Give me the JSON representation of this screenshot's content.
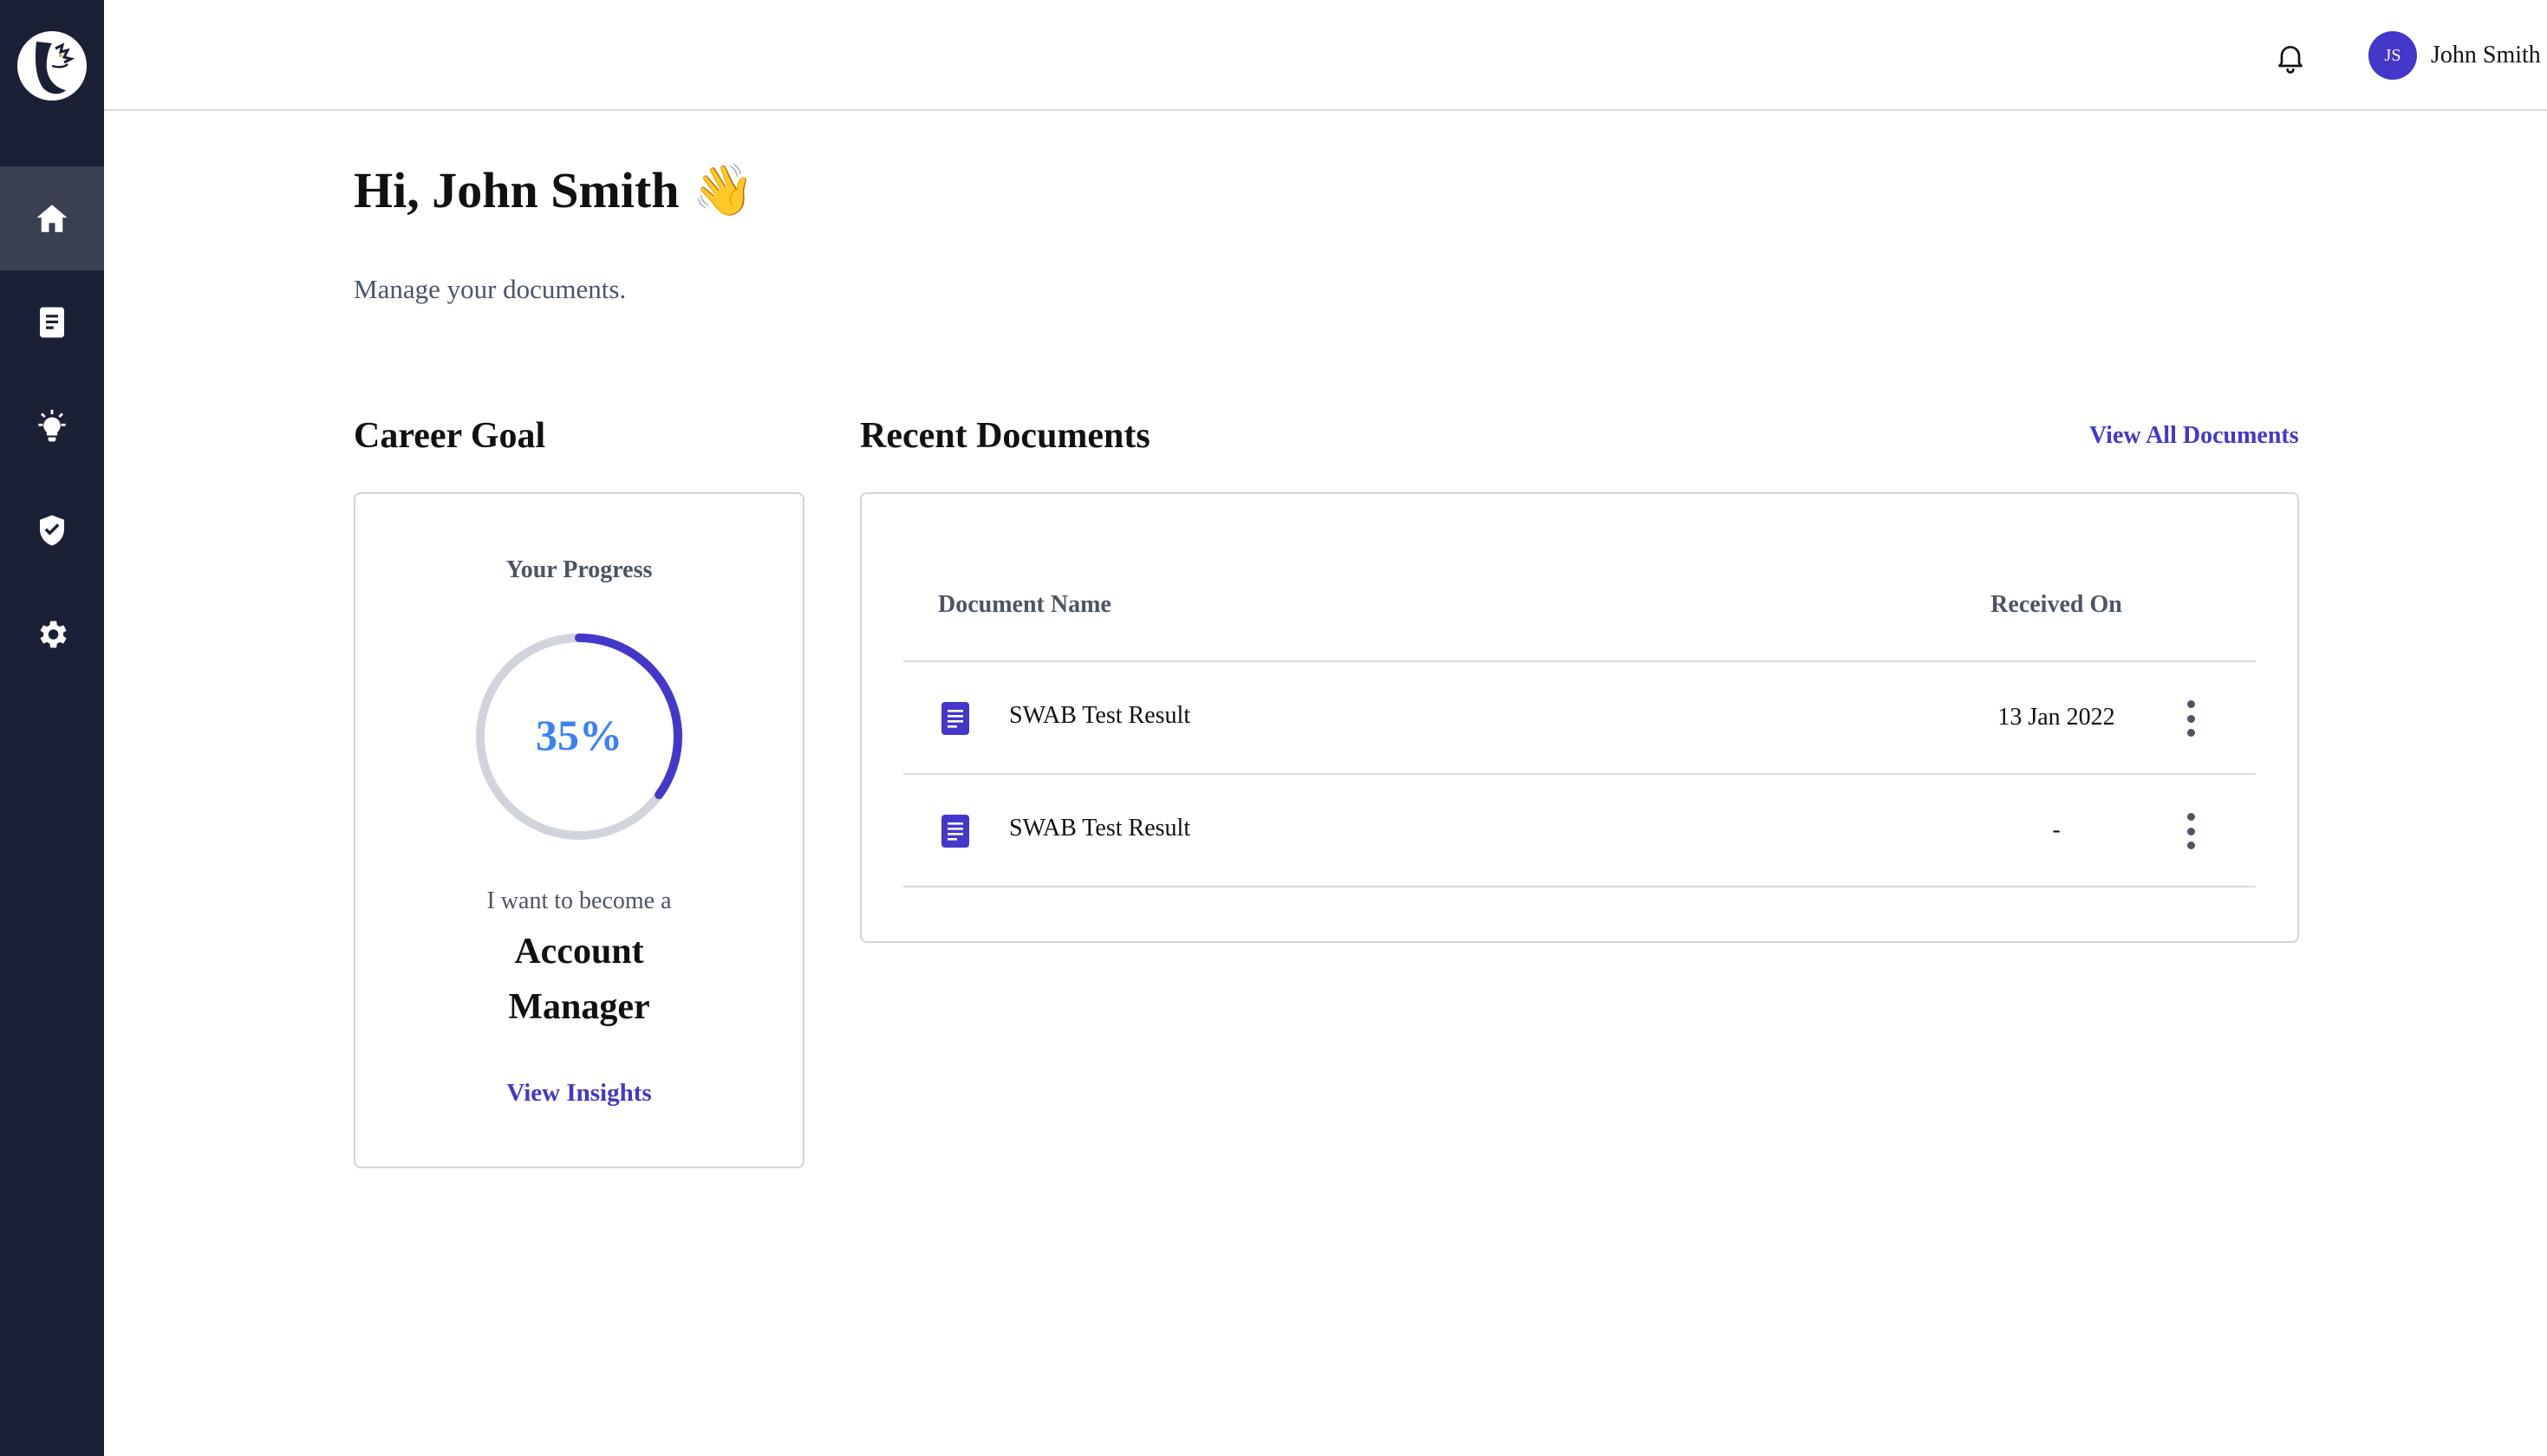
{
  "sidebar": {
    "items": [
      {
        "icon": "home-icon",
        "active": true
      },
      {
        "icon": "document-icon",
        "active": false
      },
      {
        "icon": "lightbulb-icon",
        "active": false
      },
      {
        "icon": "shield-check-icon",
        "active": false
      },
      {
        "icon": "gear-icon",
        "active": false
      }
    ]
  },
  "header": {
    "user": {
      "initials": "JS",
      "name": "John Smith"
    }
  },
  "main": {
    "greeting": "Hi, John Smith 👋",
    "subtitle": "Manage your documents."
  },
  "career": {
    "title": "Career Goal",
    "progress_label": "Your Progress",
    "progress_value": 35,
    "progress_text": "35%",
    "want_text": "I want to become a",
    "goal_line1": "Account",
    "goal_line2": "Manager",
    "insights_link": "View Insights"
  },
  "documents": {
    "title": "Recent Documents",
    "view_all": "View All Documents",
    "columns": [
      "Document Name",
      "Received On"
    ],
    "rows": [
      {
        "name": "SWAB Test Result",
        "received": "13 Jan 2022"
      },
      {
        "name": "SWAB Test Result",
        "received": "-"
      }
    ]
  },
  "colors": {
    "sidebar_bg": "#1a2035",
    "accent": "#4338ca",
    "progress_text": "#3b82f6",
    "ring_track": "#d1d5db"
  }
}
